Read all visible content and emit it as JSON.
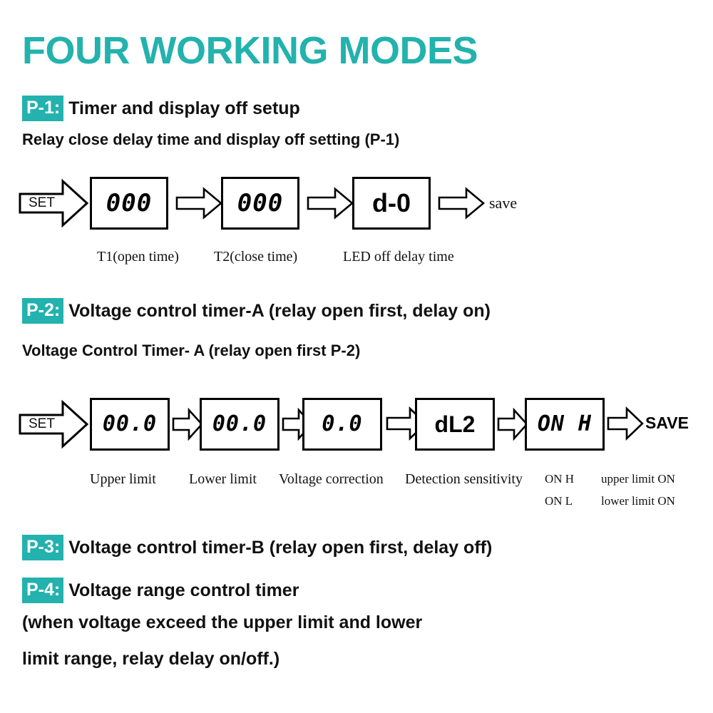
{
  "title": "FOUR WORKING MODES",
  "accent_color": "#23b2ad",
  "modes": [
    {
      "badge": "P-1:",
      "text": "Timer and display off setup"
    },
    {
      "badge": "P-2:",
      "text": "Voltage control timer-A (relay open first, delay on)"
    },
    {
      "badge": "P-3:",
      "text": "Voltage control timer-B (relay open first, delay off)"
    },
    {
      "badge": "P-4:",
      "text": "Voltage range control timer"
    }
  ],
  "p1": {
    "subhead": "Relay close delay time and display off setting (P-1)",
    "set_label": "SET",
    "boxes": [
      {
        "value": "000",
        "caption": "T1(open time)"
      },
      {
        "value": "000",
        "caption": "T2(close time)"
      },
      {
        "value": "d-0",
        "caption": "LED off delay time"
      }
    ],
    "end_label": "save"
  },
  "p2": {
    "subhead": "Voltage Control Timer- A (relay open first P-2)",
    "set_label": "SET",
    "boxes": [
      {
        "value": "00.0",
        "caption": "Upper limit"
      },
      {
        "value": "00.0",
        "caption": "Lower limit"
      },
      {
        "value": "0.0",
        "caption": "Voltage correction"
      },
      {
        "value": "dL2",
        "caption": "Detection sensitivity"
      },
      {
        "value": "ON H",
        "caption": ""
      }
    ],
    "legend": [
      {
        "code": "ON  H",
        "meaning": "upper limit ON"
      },
      {
        "code": "ON  L",
        "meaning": "lower limit ON"
      }
    ],
    "end_label": "SAVE"
  },
  "p4_notes": [
    "(when voltage exceed the upper limit and lower",
    "limit range, relay delay on/off.)"
  ]
}
